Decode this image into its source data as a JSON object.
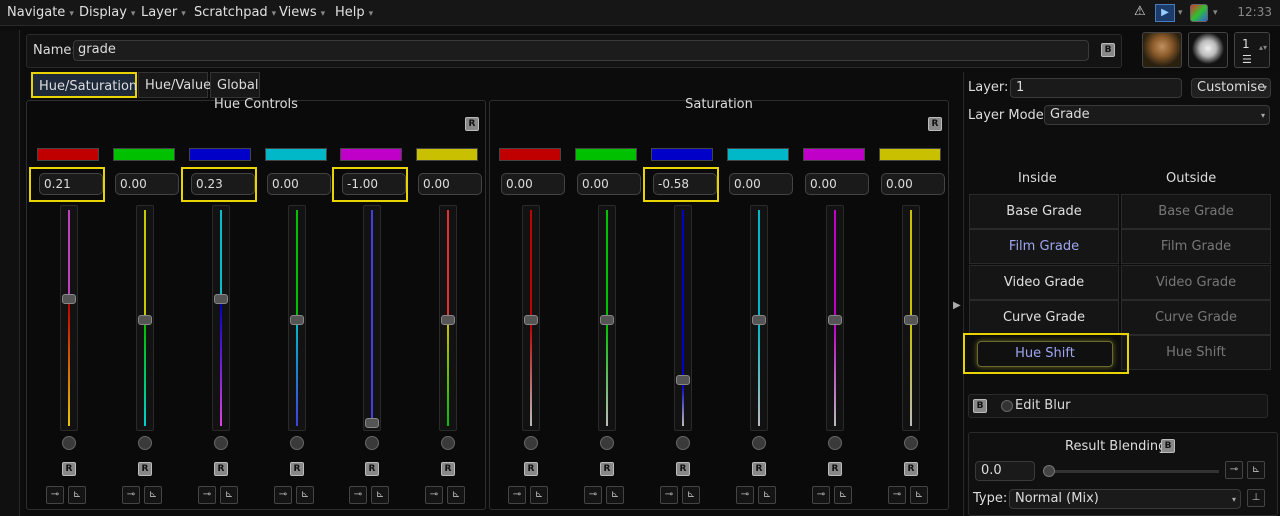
{
  "menubar": {
    "items": [
      "Navigate",
      "Display",
      "Layer",
      "Scratchpad",
      "Views",
      "Help"
    ],
    "clock": "12:33",
    "warning_icon": "warning-icon",
    "colors": {
      "highlight": "#e8d400",
      "film_text": "#9ea6f0"
    }
  },
  "name": {
    "label": "Name:",
    "value": "grade",
    "b_label": "B"
  },
  "thumbs": {
    "count_label": "1"
  },
  "tabs": [
    "Hue/Saturation",
    "Hue/Value",
    "Global"
  ],
  "hue": {
    "title": "Hue Controls",
    "reset": "R",
    "swatches": [
      "#c00000",
      "#00c000",
      "#0000c8",
      "#00b8c8",
      "#c000c8",
      "#c8c000"
    ],
    "values": [
      "0.21",
      "0.00",
      "0.23",
      "0.00",
      "-1.00",
      "0.00"
    ],
    "slider_levels": [
      0.6,
      0.5,
      0.6,
      0.5,
      0.0,
      0.5
    ]
  },
  "saturation": {
    "title": "Saturation",
    "reset": "R",
    "swatches": [
      "#c00000",
      "#00c000",
      "#0000c8",
      "#00b8c8",
      "#c000c8",
      "#c8c000"
    ],
    "values": [
      "0.00",
      "0.00",
      "-0.58",
      "0.00",
      "0.00",
      "0.00"
    ],
    "slider_levels": [
      0.5,
      0.5,
      0.21,
      0.5,
      0.5,
      0.5
    ]
  },
  "right": {
    "layer_label": "Layer:",
    "layer_value": "1",
    "customise": "Customise",
    "layer_mode_label": "Layer Mode:",
    "layer_mode_value": "Grade",
    "inside": "Inside",
    "outside": "Outside",
    "grades": [
      "Base Grade",
      "Film Grade",
      "Video Grade",
      "Curve Grade",
      "Hue Shift"
    ],
    "edit_blur": "Edit Blur",
    "result_blending": "Result Blending",
    "blend_value": "0.0",
    "type_label": "Type:",
    "type_value": "Normal (Mix)",
    "b_label": "B"
  }
}
